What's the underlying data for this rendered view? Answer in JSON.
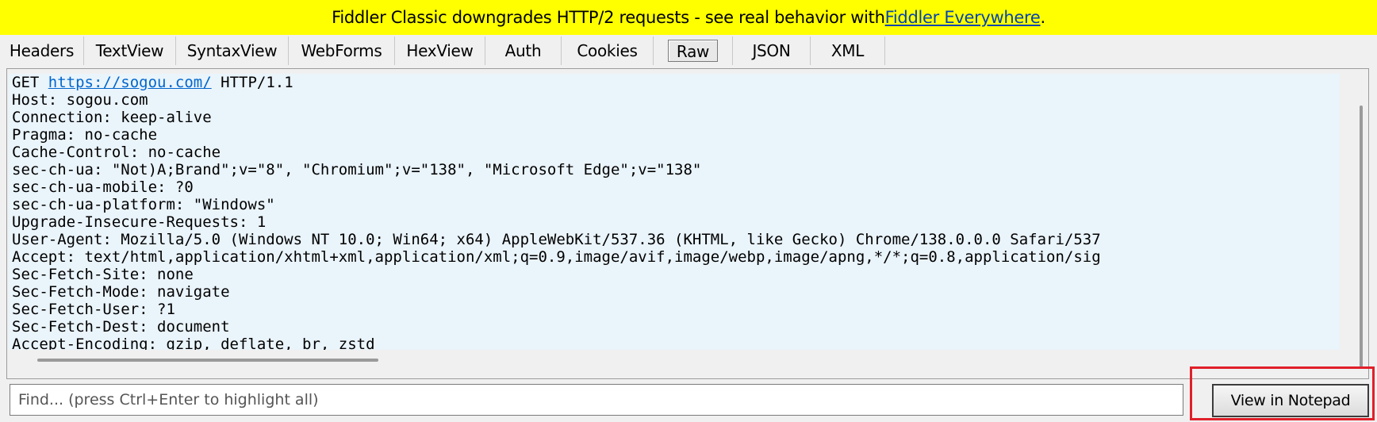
{
  "banner": {
    "text": "Fiddler Classic downgrades HTTP/2 requests - see real behavior with ",
    "link": "Fiddler Everywhere",
    "suffix": "."
  },
  "tabs": [
    {
      "label": "Headers",
      "active": false
    },
    {
      "label": "TextView",
      "active": false
    },
    {
      "label": "SyntaxView",
      "active": false
    },
    {
      "label": "WebForms",
      "active": false
    },
    {
      "label": "HexView",
      "active": false
    },
    {
      "label": "Auth",
      "active": false
    },
    {
      "label": "Cookies",
      "active": false
    },
    {
      "label": "Raw",
      "active": true
    },
    {
      "label": "JSON",
      "active": false
    },
    {
      "label": "XML",
      "active": false
    }
  ],
  "request": {
    "method": "GET",
    "url": "https://sogou.com/",
    "protocol": "HTTP/1.1",
    "headers": [
      "Host: sogou.com",
      "Connection: keep-alive",
      "Pragma: no-cache",
      "Cache-Control: no-cache",
      "sec-ch-ua: \"Not)A;Brand\";v=\"8\", \"Chromium\";v=\"138\", \"Microsoft Edge\";v=\"138\"",
      "sec-ch-ua-mobile: ?0",
      "sec-ch-ua-platform: \"Windows\"",
      "Upgrade-Insecure-Requests: 1",
      "User-Agent: Mozilla/5.0 (Windows NT 10.0; Win64; x64) AppleWebKit/537.36 (KHTML, like Gecko) Chrome/138.0.0.0 Safari/537",
      "Accept: text/html,application/xhtml+xml,application/xml;q=0.9,image/avif,image/webp,image/apng,*/*;q=0.8,application/sig",
      "Sec-Fetch-Site: none",
      "Sec-Fetch-Mode: navigate",
      "Sec-Fetch-User: ?1",
      "Sec-Fetch-Dest: document",
      "Accept-Encoding: gzip, deflate, br, zstd"
    ]
  },
  "find": {
    "placeholder": "Find... (press Ctrl+Enter to highlight all)",
    "value": ""
  },
  "buttons": {
    "view_in_notepad": "View in Notepad"
  },
  "colors": {
    "banner_bg": "#ffff00",
    "text_bg": "#eaf4fb",
    "link": "#0066cc",
    "highlight": "#e0202a"
  }
}
